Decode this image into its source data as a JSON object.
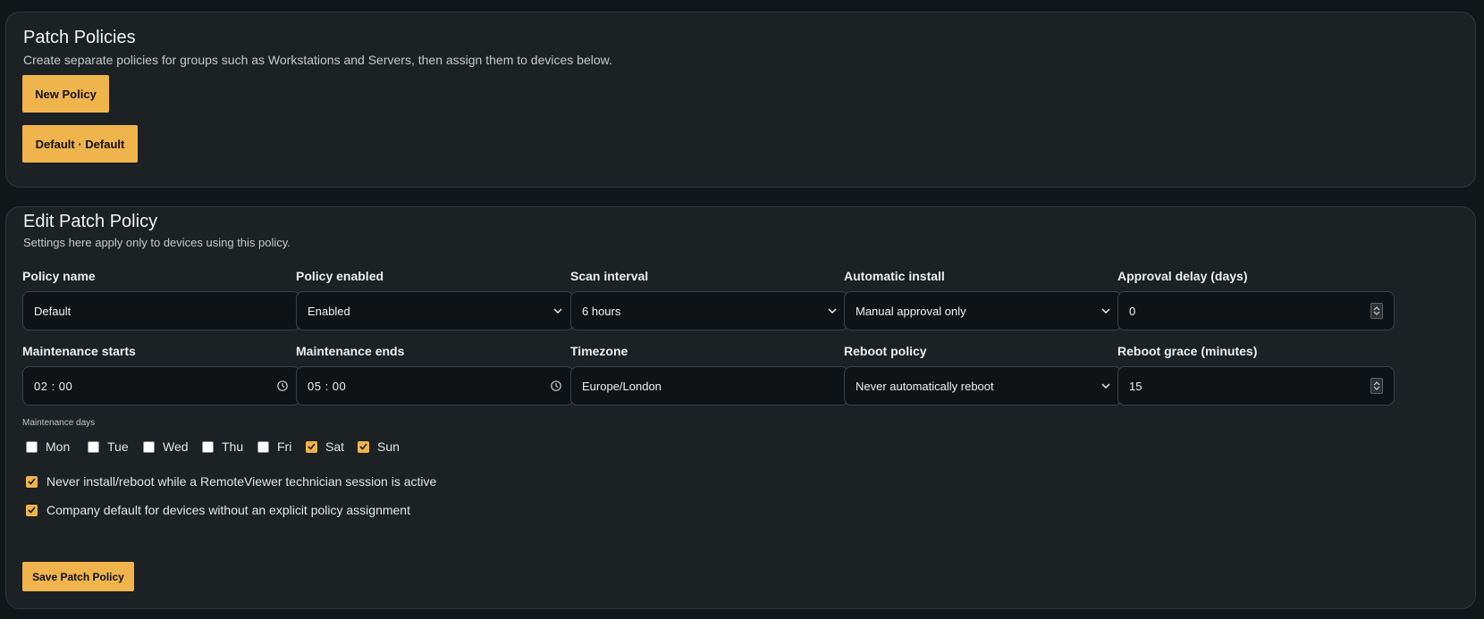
{
  "policies": {
    "title": "Patch Policies",
    "subtitle": "Create separate policies for groups such as Workstations and Servers, then assign them to devices below.",
    "new_policy_label": "New Policy",
    "items": [
      {
        "label": "Default · Default"
      }
    ]
  },
  "edit": {
    "title": "Edit Patch Policy",
    "subtitle": "Settings here apply only to devices using this policy.",
    "fields": {
      "policy_name": {
        "label": "Policy name",
        "value": "Default"
      },
      "policy_enabled": {
        "label": "Policy enabled",
        "value": "Enabled"
      },
      "scan_interval": {
        "label": "Scan interval",
        "value": "6 hours"
      },
      "automatic_install": {
        "label": "Automatic install",
        "value": "Manual approval only"
      },
      "approval_delay": {
        "label": "Approval delay (days)",
        "value": "0"
      },
      "maintenance_starts": {
        "label": "Maintenance starts",
        "value": "02 : 00"
      },
      "maintenance_ends": {
        "label": "Maintenance ends",
        "value": "05 : 00"
      },
      "timezone": {
        "label": "Timezone",
        "value": "Europe/London"
      },
      "reboot_policy": {
        "label": "Reboot policy",
        "value": "Never automatically reboot"
      },
      "reboot_grace": {
        "label": "Reboot grace (minutes)",
        "value": "15"
      }
    },
    "maintenance_days_label": "Maintenance days",
    "days": [
      {
        "label": "Mon",
        "checked": false
      },
      {
        "label": "Tue",
        "checked": false
      },
      {
        "label": "Wed",
        "checked": false
      },
      {
        "label": "Thu",
        "checked": false
      },
      {
        "label": "Fri",
        "checked": false
      },
      {
        "label": "Sat",
        "checked": true
      },
      {
        "label": "Sun",
        "checked": true
      }
    ],
    "options": [
      {
        "label": "Never install/reboot while a RemoteViewer technician session is active",
        "checked": true
      },
      {
        "label": "Company default for devices without an explicit policy assignment",
        "checked": true
      }
    ],
    "save_label": "Save Patch Policy"
  },
  "colors": {
    "accent": "#f0b44c",
    "background": "#111619",
    "card": "#1c2124",
    "input": "#0f1316"
  }
}
